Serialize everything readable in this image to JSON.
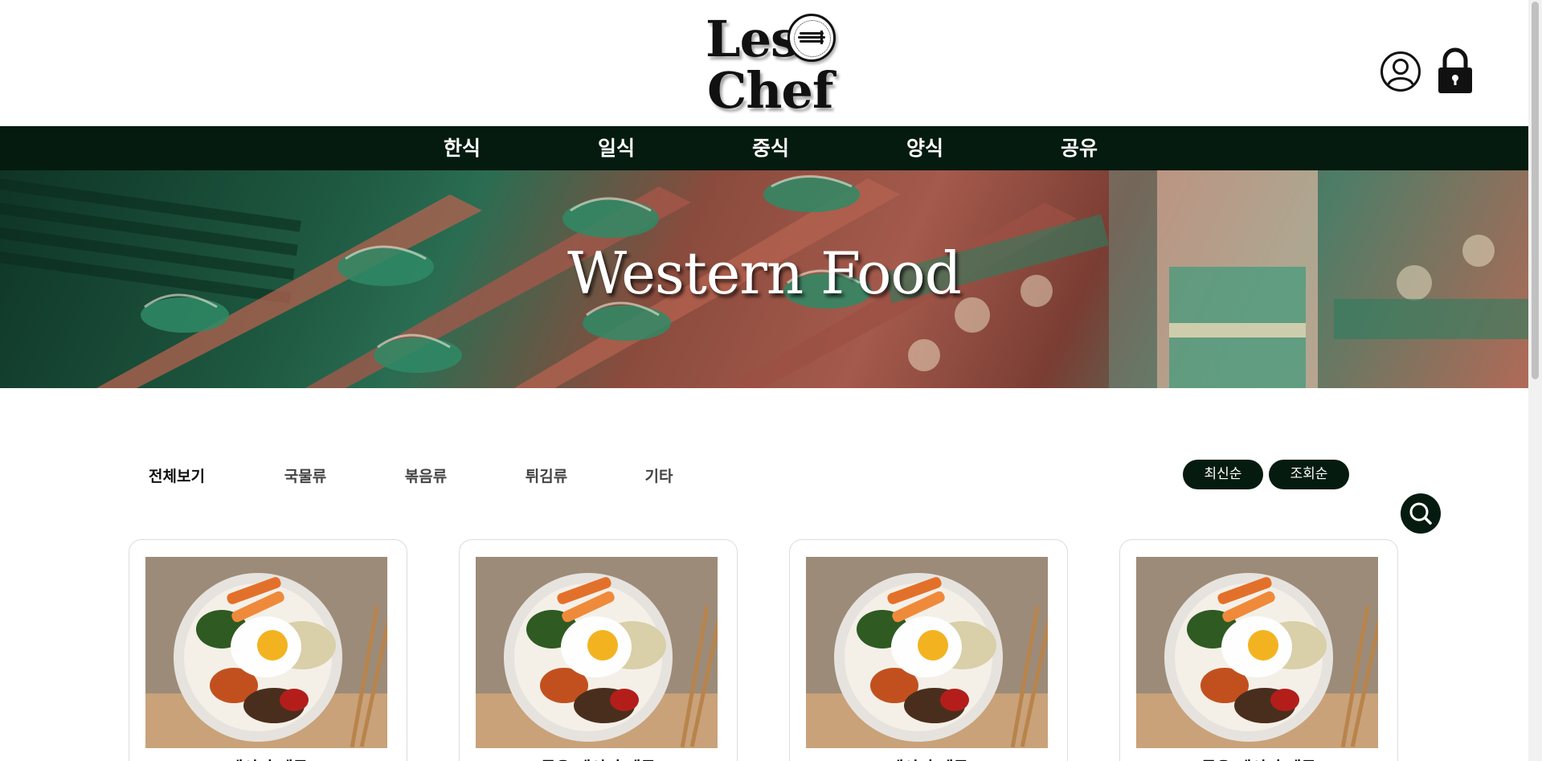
{
  "header": {
    "logo_line1": "Les",
    "logo_line2": "Chef"
  },
  "nav": {
    "items": [
      {
        "label": "한식"
      },
      {
        "label": "일식"
      },
      {
        "label": "중식"
      },
      {
        "label": "양식"
      },
      {
        "label": "공유"
      }
    ]
  },
  "hero": {
    "title": "Western Food"
  },
  "filters": {
    "categories": [
      {
        "label": "전체보기",
        "active": true
      },
      {
        "label": "국물류"
      },
      {
        "label": "볶음류"
      },
      {
        "label": "튀김류"
      },
      {
        "label": "기타"
      }
    ],
    "sort": [
      {
        "label": "최신순"
      },
      {
        "label": "조회순"
      }
    ]
  },
  "cards": [
    {
      "title": "레시피 제목"
    },
    {
      "title": "공유 레시피 제목"
    },
    {
      "title": "레시피 제목"
    },
    {
      "title": "공유 레시피 제목"
    }
  ],
  "colors": {
    "accent": "#051b10",
    "background": "#ffffff"
  },
  "icons": {
    "user": "user-circle-icon",
    "lock": "lock-icon",
    "search": "search-icon"
  }
}
